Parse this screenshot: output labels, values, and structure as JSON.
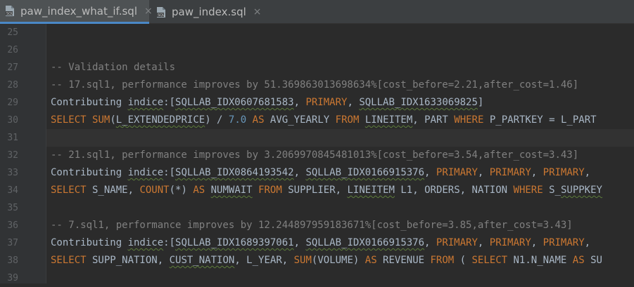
{
  "tabs": [
    {
      "label": "paw_index_what_if.sql",
      "close": "×",
      "icon": "sql-file-icon",
      "active": true
    },
    {
      "label": "paw_index.sql",
      "close": "×",
      "icon": "sql-file-icon",
      "active": false
    }
  ],
  "line_numbers": [
    "25",
    "26",
    "27",
    "28",
    "29",
    "30",
    "31",
    "32",
    "33",
    "34",
    "35",
    "36",
    "37",
    "38",
    "39"
  ],
  "code": {
    "l27": "-- Validation details",
    "l28": "-- 17.sql1, performance improves by 51.369863013698634%[cost_before=2.21,after_cost=1.46]",
    "l29": {
      "a": "Contributing ",
      "b": "indice",
      "c": ":[",
      "d": "SQLLAB_IDX0607681583",
      "e": ", ",
      "f": "PRIMARY",
      "g": ", ",
      "h": "SQLLAB_IDX1633069825",
      "i": "]"
    },
    "l30": {
      "a": "SELECT",
      "b": " ",
      "c": "SUM",
      "d": "(",
      "e": "L_EXTENDEDPRICE",
      "f": ") / ",
      "g": "7.0",
      "h": " ",
      "i": "AS",
      "j": " AVG_YEARLY ",
      "k": "FROM",
      "l": " ",
      "m": "LINEITEM",
      "n": ", PART ",
      "o": "WHERE",
      "p": " P_PARTKEY = L_PART"
    },
    "l32": "-- 21.sql1, performance improves by 3.2069970845481013%[cost_before=3.54,after_cost=3.43]",
    "l33": {
      "a": "Contributing ",
      "b": "indice",
      "c": ":[",
      "d": "SQLLAB_IDX0864193542",
      "e": ", ",
      "f": "SQLLAB_IDX0166915376",
      "g": ", ",
      "h": "PRIMARY",
      "i": ", ",
      "j": "PRIMARY",
      "k": ", ",
      "l": "PRIMARY",
      "m": ","
    },
    "l34": {
      "a": "SELECT",
      "b": " S_NAME, ",
      "c": "COUNT",
      "d": "(*) ",
      "e": "AS",
      "f": " ",
      "g": "NUMWAIT",
      "h": " ",
      "i": "FROM",
      "j": " SUPPLIER, ",
      "k": "LINEITEM",
      "l": " L1, ORDERS, NATION ",
      "m": "WHERE",
      "n": " S_",
      "o": "SUPPKEY"
    },
    "l36": "-- 7.sql1, performance improves by 12.244897959183671%[cost_before=3.85,after_cost=3.43]",
    "l37": {
      "a": "Contributing ",
      "b": "indice",
      "c": ":[",
      "d": "SQLLAB_IDX1689397061",
      "e": ", ",
      "f": "SQLLAB_IDX0166915376",
      "g": ", ",
      "h": "PRIMARY",
      "i": ", ",
      "j": "PRIMARY",
      "k": ", ",
      "l": "PRIMARY",
      "m": ","
    },
    "l38": {
      "a": "SELECT",
      "b": " SUPP_NATION, ",
      "c": "CUST_NATION",
      "d": ", L_YEAR, ",
      "e": "SUM",
      "f": "(VOLUME) ",
      "g": "AS",
      "h": " REVENUE ",
      "i": "FROM",
      "j": " ( ",
      "k": "SELECT",
      "l": " N1.N_NAME ",
      "m": "AS",
      "n": " SU"
    }
  }
}
